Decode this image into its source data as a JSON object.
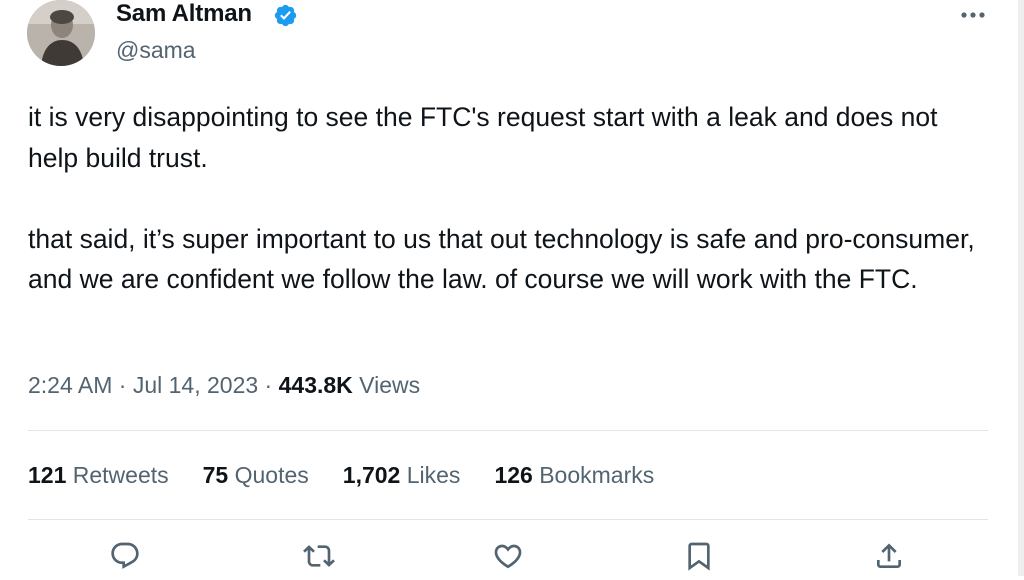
{
  "author": {
    "name": "Sam Altman",
    "handle": "@sama",
    "verified_color": "#1d9bf0"
  },
  "tweet": {
    "paragraphs": [
      "it is very disappointing to see the FTC's request start with a leak and does not help build trust.",
      "that said, it’s super important to us that out technology is safe and pro-consumer, and we are confident we follow the law. of course we will work with the FTC."
    ]
  },
  "meta": {
    "time": "2:24 AM",
    "sep1": " · ",
    "date": "Jul 14, 2023",
    "sep2": " · ",
    "views_count": "443.8K",
    "views_label": " Views"
  },
  "stats": {
    "retweets": {
      "count": "121",
      "label": " Retweets"
    },
    "quotes": {
      "count": "75",
      "label": " Quotes"
    },
    "likes": {
      "count": "1,702",
      "label": " Likes"
    },
    "bookmarks": {
      "count": "126",
      "label": " Bookmarks"
    }
  },
  "actions": [
    "reply-icon",
    "retweet-icon",
    "like-icon",
    "bookmark-icon",
    "share-icon"
  ],
  "colors": {
    "text": "#0f1419",
    "secondary": "#536471",
    "divider": "#e1e6ea"
  }
}
